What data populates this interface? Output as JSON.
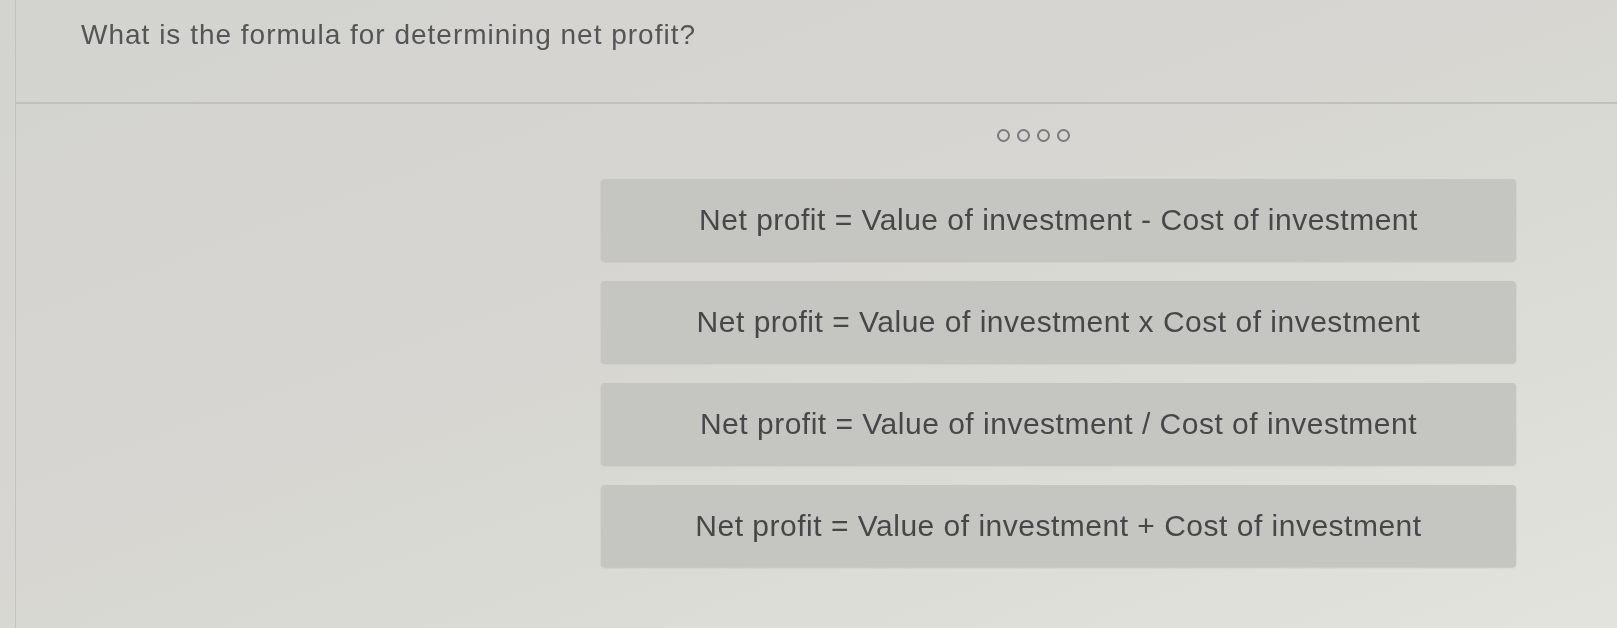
{
  "question": {
    "text": "What is the formula for determining net profit?"
  },
  "progress_dots": [
    {
      "selected": false
    },
    {
      "selected": false
    },
    {
      "selected": false
    },
    {
      "selected": false
    }
  ],
  "options": [
    {
      "label": "Net profit = Value of investment - Cost of investment",
      "selected": false
    },
    {
      "label": "Net profit = Value of investment x Cost of investment",
      "selected": false
    },
    {
      "label": "Net profit = Value of investment / Cost of investment",
      "selected": false
    },
    {
      "label": "Net profit = Value of investment + Cost of investment",
      "selected": false
    }
  ]
}
